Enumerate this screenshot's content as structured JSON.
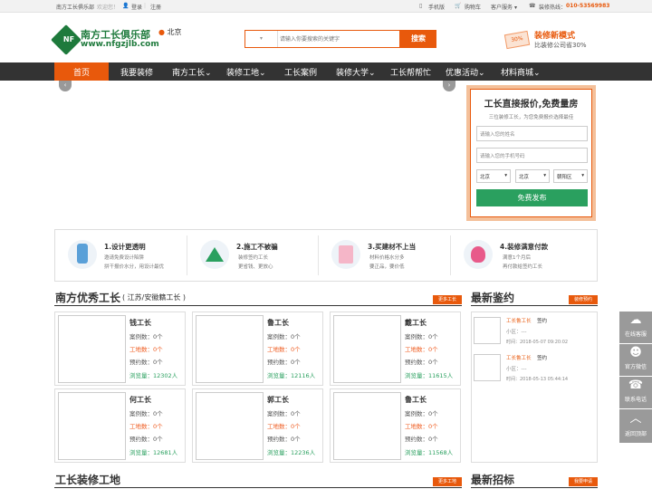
{
  "topbar": {
    "site_name": "南方工长俱乐部",
    "welcome": "欢迎您！",
    "login": "登录",
    "register": "注册",
    "mobile": "手机版",
    "cart": "购物车",
    "service": "客户服务",
    "hotline_label": "装修热线：",
    "hotline": "010-53569983"
  },
  "header": {
    "logo_mark": "NF",
    "logo_name": "南方工长俱乐部",
    "logo_domain": "www.nfgzjlb.com",
    "city": "北京",
    "search_placeholder": "请输入你要搜索的关键字",
    "search_button": "搜索",
    "promo_badge": "30%",
    "promo_title": "装修新模式",
    "promo_sub": "比装修公司省30%"
  },
  "nav": {
    "items": [
      "首页",
      "我要装修",
      "南方工长",
      "装修工地",
      "工长案例",
      "装修大学",
      "工长帮帮忙",
      "优惠活动",
      "材料商城"
    ]
  },
  "quote": {
    "title": "工长直接报价,免费量房",
    "subtitle": "三位装修工长，为您免费报价选择最佳",
    "name_placeholder": "请输入您的姓名",
    "phone_placeholder": "请输入您的手机号码",
    "province": "北京",
    "city": "北京",
    "district": "朝阳区",
    "submit": "免费发布"
  },
  "features": [
    {
      "title": "1.设计更透明",
      "line1": "邀请免费设计陷阱",
      "line2": "拼干报价水分，用设计最优"
    },
    {
      "title": "2.施工不被骗",
      "line1": "装修签约工长",
      "line2": "更省钱、更放心"
    },
    {
      "title": "3.买建材不上当",
      "line1": "材料价格水分多",
      "line2": "要正品，要价低"
    },
    {
      "title": "4.装修满意付款",
      "line1": "满意1个月后",
      "line2": "再付款给签约工长"
    }
  ],
  "foremen": {
    "title": "南方优秀工长",
    "subtitle": "( 江苏/安徽籍工长 )",
    "more": "更多工长",
    "cards": [
      {
        "name": "钱工长",
        "cases": "案例数：0个",
        "sites": "工地数：0个",
        "bookings": "预约数：0个",
        "views": "浏览量：12302人"
      },
      {
        "name": "鲁工长",
        "cases": "案例数：0个",
        "sites": "工地数：0个",
        "bookings": "预约数：0个",
        "views": "浏览量：12116人"
      },
      {
        "name": "戴工长",
        "cases": "案例数：0个",
        "sites": "工地数：0个",
        "bookings": "预约数：0个",
        "views": "浏览量：11615人"
      },
      {
        "name": "何工长",
        "cases": "案例数：0个",
        "sites": "工地数：0个",
        "bookings": "预约数：0个",
        "views": "浏览量：12681人"
      },
      {
        "name": "郭工长",
        "cases": "案例数：0个",
        "sites": "工地数：0个",
        "bookings": "预约数：0个",
        "views": "浏览量：12236人"
      },
      {
        "name": "鲁工长",
        "cases": "案例数：0个",
        "sites": "工地数：0个",
        "bookings": "预约数：0个",
        "views": "浏览量：11568人"
      }
    ]
  },
  "appraisal": {
    "title": "最新鉴约",
    "more": "装修预约",
    "items": [
      {
        "who": "工长鲁工长",
        "action": "签约",
        "area": "小区：---",
        "time": "时间：2018-05-07 09:20:02"
      },
      {
        "who": "工长鲁工长",
        "action": "签约",
        "area": "小区：---",
        "time": "时间：2018-05-13 05:44:14"
      }
    ]
  },
  "sites": {
    "title": "工长装修工地",
    "more": "更多工地"
  },
  "recruit": {
    "title": "最新招标",
    "more": "我要申请"
  },
  "side_tools": [
    "在线客服",
    "官方微信",
    "联系电话",
    "返回顶部"
  ]
}
